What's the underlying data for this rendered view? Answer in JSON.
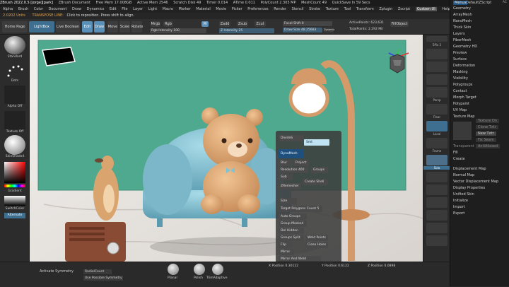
{
  "titlebar": {
    "items": [
      "ZBrush 2022.0.5 [jorge][park]",
      "ZBrush Document",
      "Free Mem 17.008GB",
      "Active Mem 2546",
      "Scratch Disk 49",
      "Timer 0.014",
      "ATime 0.011",
      "PolyCount 2.303 MP",
      "MeshCount 49",
      "QuickSave In 59 Secs"
    ],
    "right": [
      "AC",
      "QuickSave",
      "See-through 0",
      "Menus",
      "DefaultZScript"
    ]
  },
  "menubar": [
    "Alpha",
    "Brush",
    "Color",
    "Document",
    "Draw",
    "Dynamics",
    "Edit",
    "File",
    "Layer",
    "Light",
    "Macro",
    "Marker",
    "Material",
    "Movie",
    "Picker",
    "Preferences",
    "Render",
    "Stencil",
    "Stroke",
    "Texture",
    "Tool",
    "Transform",
    "Zplugin",
    "Zscript",
    "Custom UI",
    "Help"
  ],
  "notebar": {
    "version": "2.0202 Units",
    "transpose": "TRANSPOSE LINE:",
    "hint": "Click to reposition. Press shift to align."
  },
  "toolbar": {
    "home": "Home Page",
    "lightbox": "LightBox",
    "liveboolean": "Live Boolean",
    "edit": "Edit",
    "draw": "Draw",
    "move": "Move",
    "scale": "Scale",
    "rotate": "Rotate",
    "mrgb": "Mrgb",
    "rgb": "Rgb",
    "m": "M",
    "rgb_intensity": "Rgb Intensity 100",
    "zadd": "Zadd",
    "zsub": "Zsub",
    "zcut": "Zcut",
    "z_intensity": "Z Intensity 25",
    "focal": "Focal Shift 0",
    "draw_size": "Draw Size 48.25683",
    "dynamic": "Dynamic",
    "active_points": "ActivePoints: 623,631",
    "total_points": "TotalPoints: 2.292 Mil",
    "fill_object": "FillObject"
  },
  "leftshelf": {
    "standard": "Standard",
    "dots": "Dots",
    "alpha_off": "Alpha Off",
    "texture_off": "Texture Off",
    "material": "SkinShade4",
    "gradient": "Gradient",
    "switch_color": "SwitchColor",
    "alternate": "Alternate"
  },
  "rightshelf": {
    "spix": "SPix 3",
    "persp": "Persp",
    "floor": "Floor",
    "local": "Local",
    "frame": "Frame",
    "move": "Move",
    "scale": "Scale",
    "rotate": "Rotate",
    "polyf": "PolyF",
    "transp": "Transp",
    "solo": "Solo",
    "xpose": "Xpose"
  },
  "rightmenu": {
    "items": [
      "Geometry",
      "ArrayMesh",
      "NanoMesh",
      "Thick Skin",
      "Layers",
      "FiberMesh",
      "Geometry HD",
      "Preview",
      "Surface",
      "Deformation",
      "Masking",
      "Visibility",
      "Polygroups",
      "Contact",
      "Morph Target",
      "Polypaint",
      "UV Map",
      "Texture Map"
    ],
    "sub": [
      "Texture On",
      "Clone Txtr",
      "New Txtr",
      "Fix Seam",
      "AntiAliased",
      "Transparent",
      "Fill",
      "Create"
    ],
    "items2": [
      "Displacement Map",
      "Normal Map",
      "Vector Displacement Map",
      "Display Properties",
      "Unified Skin",
      "Initialize",
      "Import",
      "Export"
    ]
  },
  "popup": {
    "items": [
      "DivideS",
      "Smt",
      "DynaMesh",
      "Blur",
      "Project",
      "Resolution 400",
      "Groups",
      "Sub",
      "Create Shell",
      "ZRemesher",
      "Size",
      "Target Polygons Count 5",
      "Auto Groups",
      "Group Masked",
      "Del Hidden",
      "Weld Points",
      "Groups Split",
      "Flip",
      "Close Holes",
      "Mirror",
      "Mirror And Weld",
      "Reconstruct Subdiv",
      "Double",
      "Thick 0.02",
      "TCorne",
      "TBorde"
    ]
  },
  "bottombar": {
    "activate_symmetry": "Activate Symmetry",
    "radial_count": "RadialCount",
    "use_possible_symmetry": "Use Possible Symmetry",
    "brush1": "Planar",
    "brush2": "Polish",
    "brush3": "TrimAdaptive",
    "x_position": "X Position 0.30122",
    "y_position": "Y Position 0.6122",
    "z_position": "Z Position 0.0898"
  },
  "colors": {
    "accent": "#5a8fb8",
    "teal": "#4fa98e",
    "sofa": "#7bb7c9",
    "bear": "#d9a46e",
    "lamp": "#d49a6a"
  }
}
